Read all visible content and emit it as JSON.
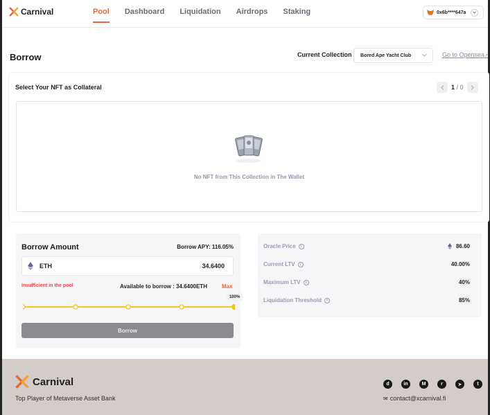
{
  "brand": {
    "name": "Carnival"
  },
  "nav": {
    "links": [
      {
        "label": "Pool",
        "active": true
      },
      {
        "label": "Dashboard",
        "active": false
      },
      {
        "label": "Liquidation",
        "active": false
      },
      {
        "label": "Airdrops",
        "active": false
      },
      {
        "label": "Staking",
        "active": false
      }
    ],
    "wallet_address": "0x6b****647a",
    "wallet_icon": "metamask-fox-icon"
  },
  "page": {
    "title": "Borrow",
    "collection_label": "Current Collection",
    "collection_selected": "Bored Ape Yacht Club",
    "opensea_link": "Go to Opensea"
  },
  "nft_section": {
    "title": "Select Your NFT as Collateral",
    "page_current": "1",
    "page_total": "/ 0",
    "empty_text": "No NFT from This Collection in The Wallet"
  },
  "borrow": {
    "title": "Borrow Amount",
    "apy": "Borrow APY: 116.05%",
    "token": "ETH",
    "amount": "34.6400",
    "insufficient": "Insufficient in the pool",
    "available": "Available to borrow :  34.6400ETH",
    "max_label": "Max",
    "slider_value_percent": 100,
    "slider_label": "100%",
    "button_label": "Borrow"
  },
  "stats": [
    {
      "label": "Oracle Price",
      "value": "86.60",
      "eth_icon": true
    },
    {
      "label": "Current LTV",
      "value": "40.00%",
      "eth_icon": false
    },
    {
      "label": "Maximum LTV",
      "value": "40%",
      "eth_icon": false
    },
    {
      "label": "Liquidation Threshold",
      "value": "85%",
      "eth_icon": false
    }
  ],
  "footer": {
    "tagline": "Top Player of Metaverse Asset Bank",
    "contact": "contact@xcarnival.fi",
    "social_icons": [
      "discord-icon",
      "linkedin-icon",
      "medium-icon",
      "reddit-icon",
      "telegram-icon",
      "twitter-icon"
    ]
  },
  "colors": {
    "accent": "#e8653a",
    "slider": "#f5c518",
    "footer_bg": "#d3ccc8",
    "error": "#e94545"
  }
}
